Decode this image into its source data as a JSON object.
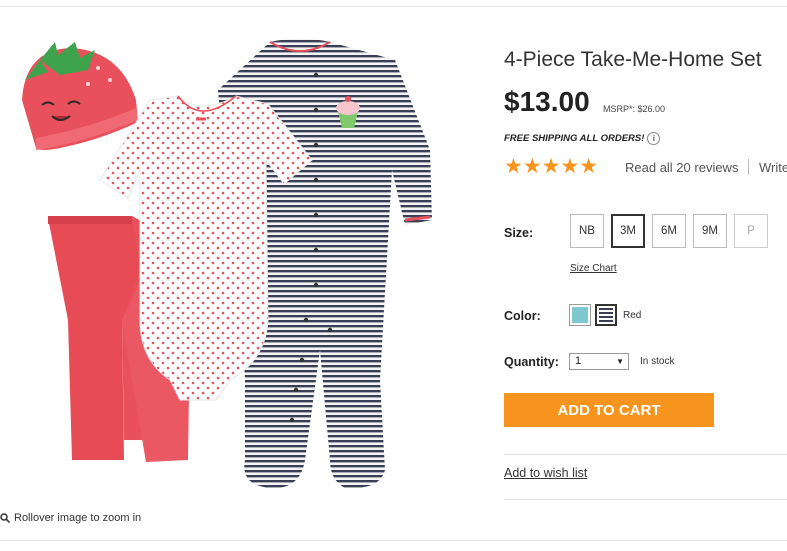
{
  "product": {
    "title": "4-Piece Take-Me-Home Set",
    "price": "$13.00",
    "msrp": "MSRP*: $26.00",
    "shipping": "FREE SHIPPING ALL ORDERS!",
    "rating_stars": "★★★★★",
    "rating": 5,
    "reviews_link": "Read all 20 reviews",
    "write_link": "Write"
  },
  "image": {
    "zoom_hint": "Rollover image to zoom in",
    "colors": {
      "red": "#e8505b",
      "navy": "#3a3f55",
      "white": "#ffffff"
    }
  },
  "size": {
    "label": "Size:",
    "options": [
      "NB",
      "3M",
      "6M",
      "9M",
      "P"
    ],
    "selected": "3M",
    "unavailable": [
      "P"
    ],
    "chart_link": "Size Chart"
  },
  "color": {
    "label": "Color:",
    "selected_name": "Red",
    "swatches": [
      "#7fc8d0",
      "#3a3f55"
    ]
  },
  "quantity": {
    "label": "Quantity:",
    "value": "1",
    "stock": "In stock"
  },
  "actions": {
    "add_to_cart": "ADD TO CART",
    "wishlist": "Add to wish list"
  },
  "theme": {
    "accent": "#f7941d"
  }
}
